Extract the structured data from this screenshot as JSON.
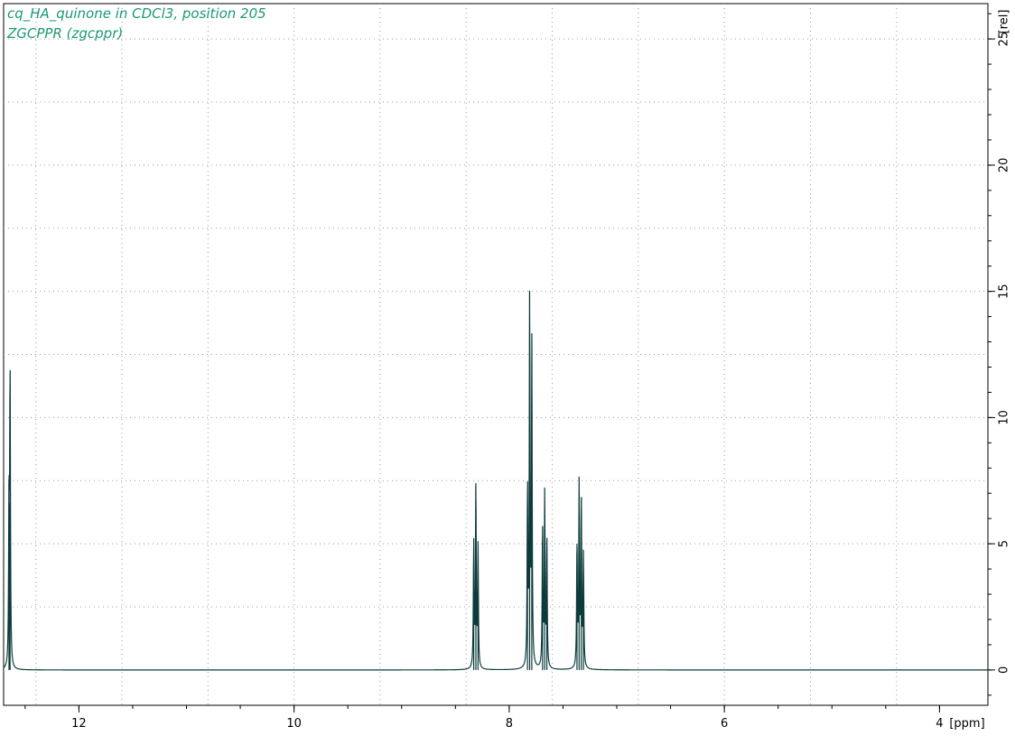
{
  "chart_data": {
    "type": "line",
    "title_lines": [
      "cq_HA_quinone in CDCl3, position 205",
      "ZGCPPR (zgcppr)"
    ],
    "xlabel": "[ppm]",
    "ylabel": "[rel]",
    "x_direction": "reversed",
    "xlim": [
      12.7,
      3.55
    ],
    "ylim": [
      -1.4,
      26.4
    ],
    "x_ticks": [
      12,
      10,
      8,
      6,
      4
    ],
    "y_ticks": [
      0,
      5,
      10,
      15,
      20,
      25
    ],
    "grid": true,
    "grid_style": "dotted",
    "series": [
      {
        "color": "#0d3b3b",
        "peaks": [
          {
            "x": 12.64,
            "y": 11.8
          },
          {
            "x": 12.65,
            "y": 6.6
          },
          {
            "x": 8.31,
            "y": 7.4
          },
          {
            "x": 8.29,
            "y": 4.8
          },
          {
            "x": 8.33,
            "y": 5.0
          },
          {
            "x": 7.81,
            "y": 14.9
          },
          {
            "x": 7.79,
            "y": 12.9
          },
          {
            "x": 7.83,
            "y": 7.0
          },
          {
            "x": 7.67,
            "y": 6.9
          },
          {
            "x": 7.65,
            "y": 5.1
          },
          {
            "x": 7.69,
            "y": 5.7
          },
          {
            "x": 7.35,
            "y": 7.2
          },
          {
            "x": 7.33,
            "y": 6.8
          },
          {
            "x": 7.37,
            "y": 5.0
          },
          {
            "x": 7.31,
            "y": 4.5
          }
        ]
      }
    ]
  }
}
